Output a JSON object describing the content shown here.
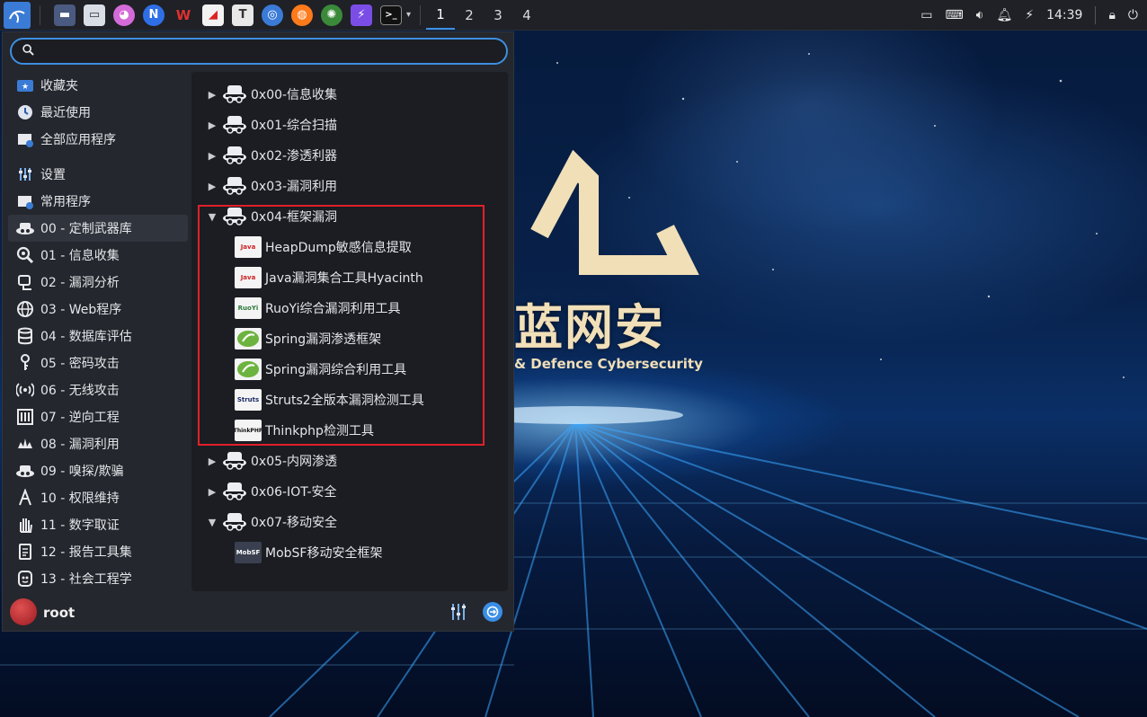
{
  "taskbar": {
    "workspaces": [
      "1",
      "2",
      "3",
      "4"
    ],
    "clock": "14:39",
    "app_icons": [
      "kali-menu-icon",
      "desktop-icon",
      "file-manager-icon",
      "cat-app-icon",
      "notion-icon",
      "wps-icon",
      "pdf-icon",
      "typora-icon",
      "chromium-icon",
      "firefox-icon",
      "burp-icon",
      "flash-icon",
      "terminal-icon"
    ]
  },
  "search": {
    "value": "",
    "placeholder": ""
  },
  "categories": [
    {
      "label": "收藏夹",
      "icon": "favorites-icon"
    },
    {
      "label": "最近使用",
      "icon": "recent-icon"
    },
    {
      "label": "全部应用程序",
      "icon": "all-apps-icon"
    },
    {
      "label": "设置",
      "icon": "settings-icon"
    },
    {
      "label": "常用程序",
      "icon": "common-apps-icon"
    },
    {
      "label": "00 - 定制武器库",
      "icon": "arsenal-icon"
    },
    {
      "label": "01 - 信息收集",
      "icon": "magnifier-icon"
    },
    {
      "label": "02 - 漏洞分析",
      "icon": "vuln-analysis-icon"
    },
    {
      "label": "03 - Web程序",
      "icon": "web-icon"
    },
    {
      "label": "04 - 数据库评估",
      "icon": "database-icon"
    },
    {
      "label": "05 - 密码攻击",
      "icon": "key-icon"
    },
    {
      "label": "06 - 无线攻击",
      "icon": "wireless-icon"
    },
    {
      "label": "07 - 逆向工程",
      "icon": "reverse-icon"
    },
    {
      "label": "08 - 漏洞利用",
      "icon": "exploit-icon"
    },
    {
      "label": "09 - 嗅探/欺骗",
      "icon": "sniff-icon"
    },
    {
      "label": "10 - 权限维持",
      "icon": "persistence-icon"
    },
    {
      "label": "11 - 数字取证",
      "icon": "forensics-icon"
    },
    {
      "label": "12 - 报告工具集",
      "icon": "report-icon"
    },
    {
      "label": "13 - 社会工程学",
      "icon": "social-icon"
    }
  ],
  "tree": {
    "folders": [
      {
        "label": "0x00-信息收集",
        "expanded": false
      },
      {
        "label": "0x01-综合扫描",
        "expanded": false
      },
      {
        "label": "0x02-渗透利器",
        "expanded": false
      },
      {
        "label": "0x03-漏洞利用",
        "expanded": false
      },
      {
        "label": "0x04-框架漏洞",
        "expanded": true
      },
      {
        "label": "0x05-内网渗透",
        "expanded": false
      },
      {
        "label": "0x06-IOT-安全",
        "expanded": false
      },
      {
        "label": "0x07-移动安全",
        "expanded": true
      }
    ],
    "framework_items": [
      {
        "label": "HeapDump敏感信息提取",
        "icon": "java-icon",
        "badge": "Java"
      },
      {
        "label": "Java漏洞集合工具Hyacinth",
        "icon": "java-icon",
        "badge": "Java"
      },
      {
        "label": "RuoYi综合漏洞利用工具",
        "icon": "ruoyi-icon",
        "badge": "RuoYi"
      },
      {
        "label": "Spring漏洞渗透框架",
        "icon": "spring-icon",
        "badge": ""
      },
      {
        "label": "Spring漏洞综合利用工具",
        "icon": "spring-icon",
        "badge": ""
      },
      {
        "label": "Struts2全版本漏洞检测工具",
        "icon": "struts-icon",
        "badge": "Struts"
      },
      {
        "label": "Thinkphp检测工具",
        "icon": "thinkphp-icon",
        "badge": "ThinkPHP"
      }
    ],
    "mobile_items": [
      {
        "label": "MobSF移动安全框架",
        "icon": "mobsf-icon",
        "badge": "MobSF"
      }
    ]
  },
  "footer": {
    "username": "root"
  },
  "wallpaper": {
    "title": "蓝网安",
    "subtitle": "& Defence Cybersecurity"
  },
  "colors": {
    "accent": "#3a8ee6",
    "highlight_box": "#e0202a",
    "panel": "#24272d"
  }
}
